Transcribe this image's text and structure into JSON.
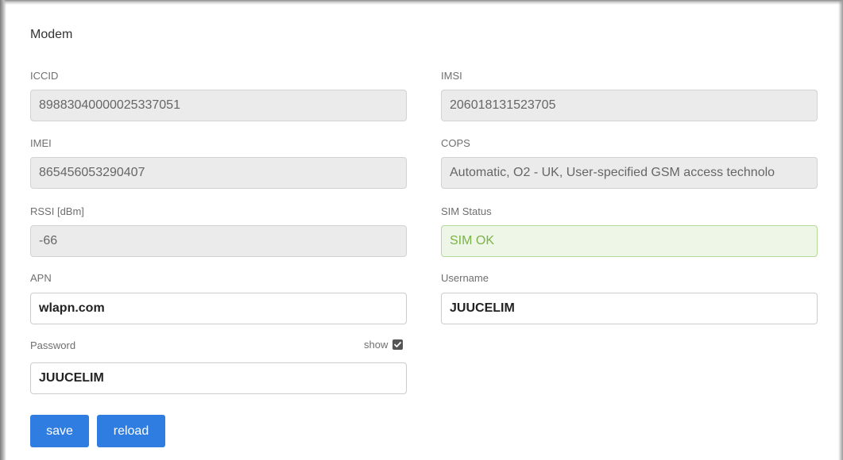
{
  "panel": {
    "title": "Modem"
  },
  "fields": {
    "iccid": {
      "label": "ICCID",
      "value": "89883040000025337051"
    },
    "imsi": {
      "label": "IMSI",
      "value": "206018131523705"
    },
    "imei": {
      "label": "IMEI",
      "value": "865456053290407"
    },
    "cops": {
      "label": "COPS",
      "value": "Automatic, O2 - UK, User-specified GSM access technolo"
    },
    "rssi": {
      "label": "RSSI [dBm]",
      "value": "-66"
    },
    "sim_status": {
      "label": "SIM Status",
      "value": "SIM OK",
      "status_color": "#7bb349"
    },
    "apn": {
      "label": "APN",
      "value": "wlapn.com"
    },
    "username": {
      "label": "Username",
      "value": "JUUCELIM"
    },
    "password": {
      "label": "Password",
      "value": "JUUCELIM",
      "show_label": "show",
      "show_checked": true
    }
  },
  "buttons": {
    "save": "save",
    "reload": "reload"
  },
  "colors": {
    "accent": "#2f7de1",
    "readonly_bg": "#ebebeb",
    "ok_border": "#b4db95"
  }
}
